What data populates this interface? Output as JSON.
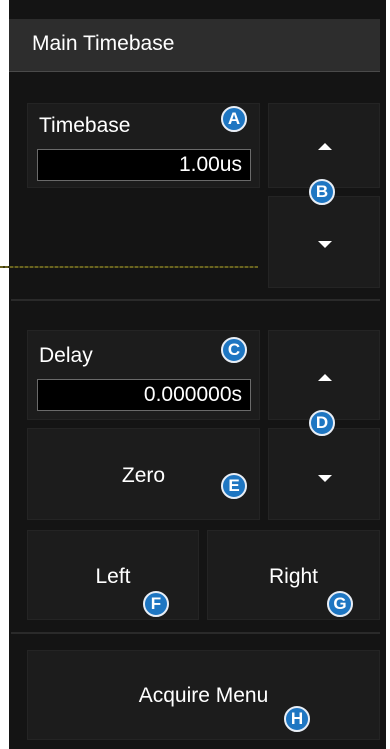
{
  "header": {
    "title": "Main Timebase"
  },
  "timebase": {
    "label": "Timebase",
    "value": "1.00us"
  },
  "delay": {
    "label": "Delay",
    "value": "0.000000s"
  },
  "buttons": {
    "zero": "Zero",
    "left": "Left",
    "right": "Right",
    "acquire_menu": "Acquire Menu"
  },
  "icons": {
    "up": "arrow-up-icon",
    "down": "arrow-down-icon"
  },
  "callouts": {
    "a": "A",
    "b": "B",
    "c": "C",
    "d": "D",
    "e": "E",
    "f": "F",
    "g": "G",
    "h": "H"
  },
  "colors": {
    "panel_bg": "#141414",
    "header_bg": "#2d2d2d",
    "tile_bg": "#1c1c1c",
    "callout_blue": "#1e76c2",
    "trace": "#6a6420"
  }
}
